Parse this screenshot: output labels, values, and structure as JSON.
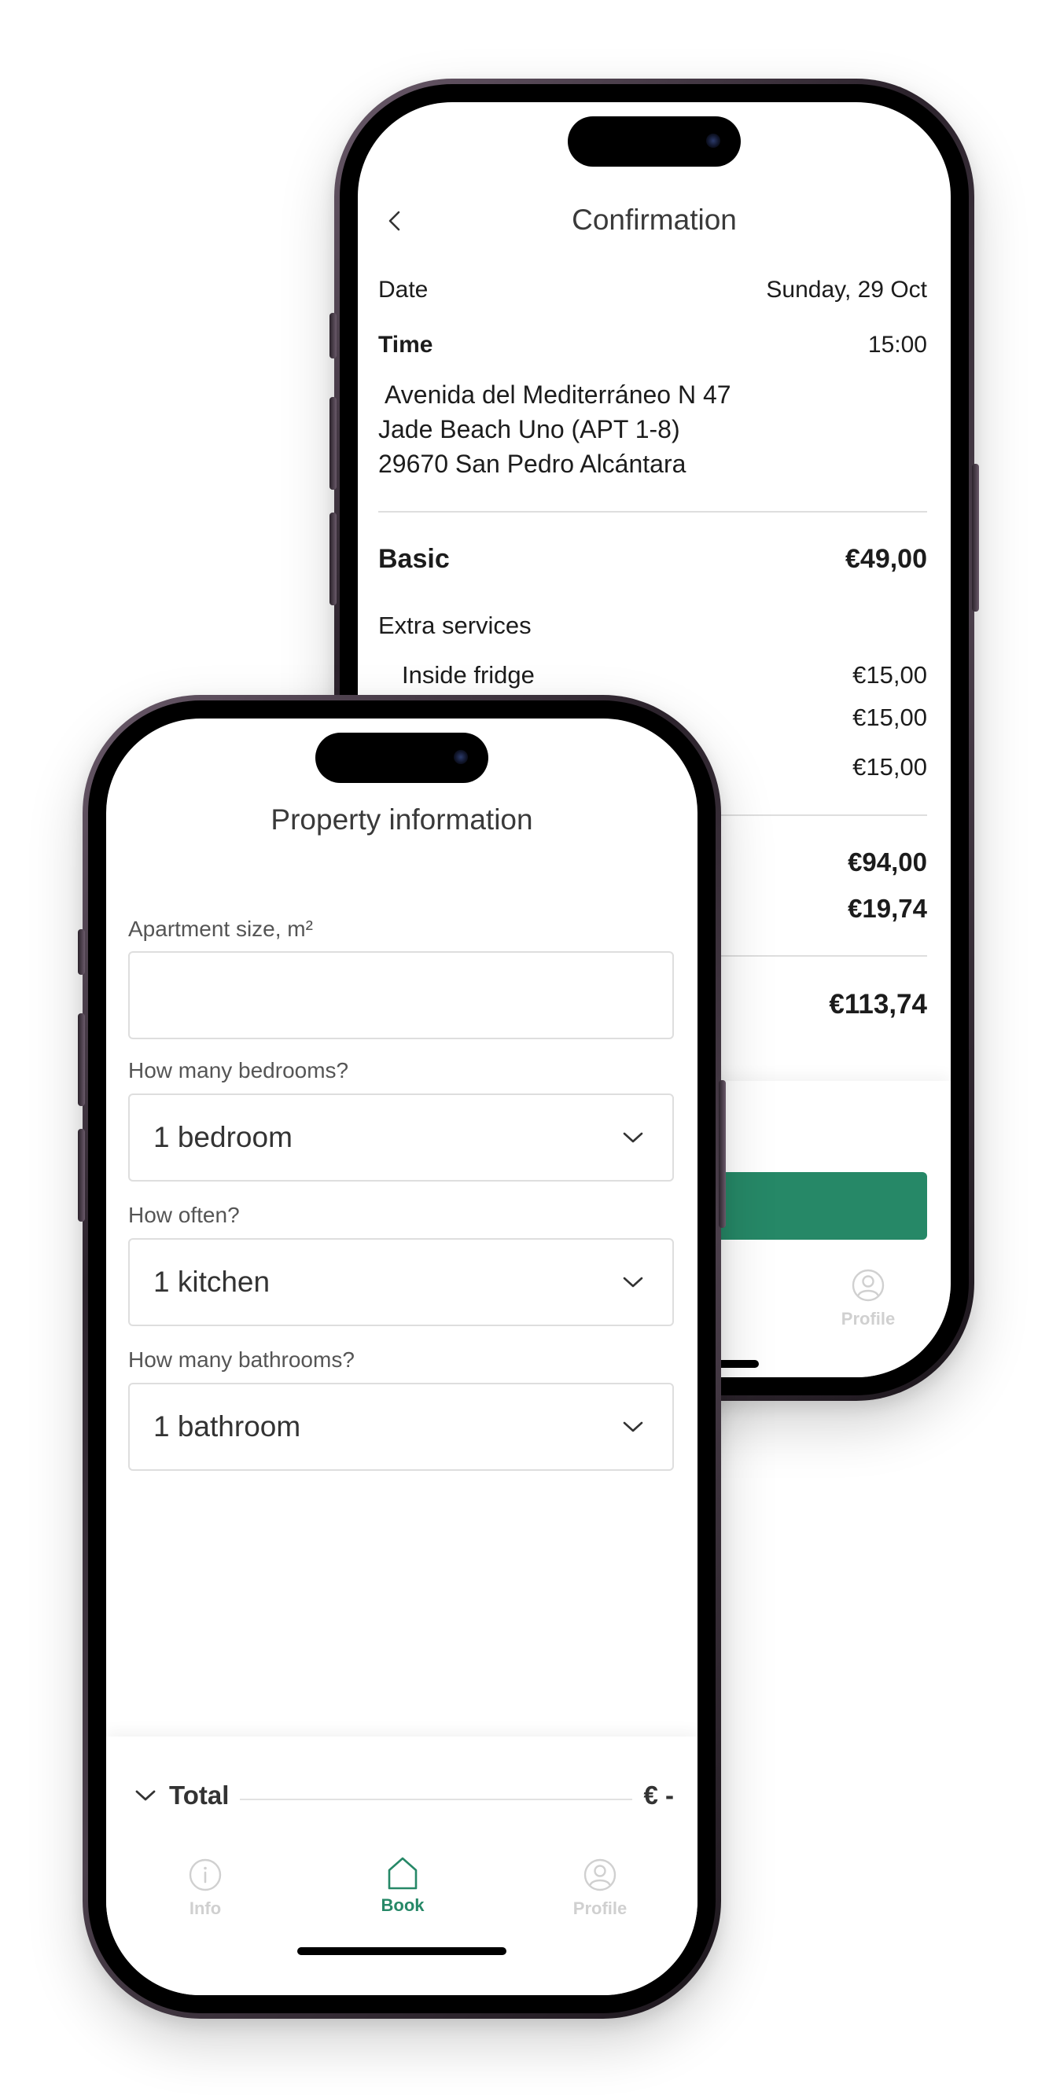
{
  "colors": {
    "accent": "#268867",
    "inactive_tab": "#d0d0d0",
    "text": "#1c1c1c"
  },
  "back_screen": {
    "title": "Confirmation",
    "date_label": "Date",
    "date_value": "Sunday, 29 Oct",
    "time_label": "Time",
    "time_value": "15:00",
    "address_lines": [
      "Avenida del Mediterráneo N 47",
      "Jade Beach Uno (APT 1-8)",
      "29670 San Pedro Alcántara"
    ],
    "basic_label": "Basic",
    "basic_price": "€49,00",
    "extras_label": "Extra services",
    "extras": [
      {
        "label": "Inside fridge",
        "price": "€15,00"
      },
      {
        "label": "",
        "price": "€15,00"
      },
      {
        "label": "",
        "price": "€15,00"
      }
    ],
    "subtotal": "€94,00",
    "tax": "€19,74",
    "total": "€113,74",
    "tabs": {
      "profile": "Profile"
    },
    "icons": {
      "back": "chevron-left-icon",
      "profile": "profile-icon"
    }
  },
  "front_screen": {
    "title": "Property information",
    "fields": {
      "apartment_size_label": "Apartment size, m²",
      "apartment_size_value": "",
      "bedrooms_label": "How many bedrooms?",
      "bedrooms_value": "1 bedroom",
      "often_label": "How often?",
      "often_value": "1 kitchen",
      "bathrooms_label": "How many bathrooms?",
      "bathrooms_value": "1 bathroom"
    },
    "total_label": "Total",
    "total_value": "€ -",
    "tabs": {
      "info": "Info",
      "book": "Book",
      "profile": "Profile"
    },
    "icons": {
      "dropdown": "chevron-down-icon",
      "info": "info-icon",
      "book": "home-icon",
      "profile": "profile-icon"
    }
  }
}
